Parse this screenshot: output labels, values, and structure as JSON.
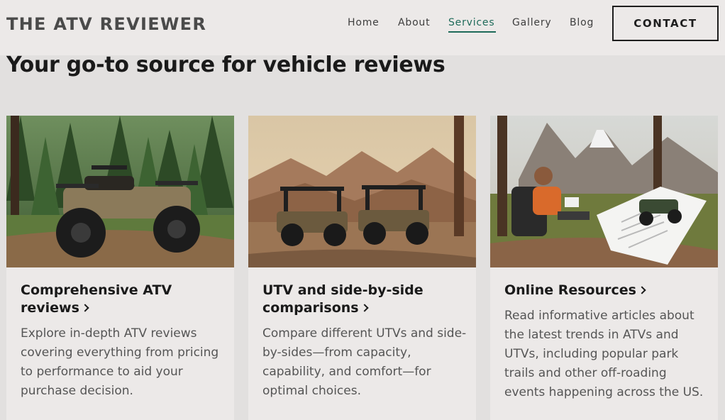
{
  "header": {
    "logo": "THE ATV REVIEWER",
    "nav": [
      {
        "label": "Home",
        "active": false
      },
      {
        "label": "About",
        "active": false
      },
      {
        "label": "Services",
        "active": true
      },
      {
        "label": "Gallery",
        "active": false
      },
      {
        "label": "Blog",
        "active": false
      }
    ],
    "contact_label": "CONTACT"
  },
  "hero": {
    "heading": "Your go-to source for vehicle reviews"
  },
  "cards": [
    {
      "title": "Comprehensive ATV reviews",
      "description": "Explore in-depth ATV reviews covering everything from pricing to performance to aid your purchase decision.",
      "image": "atv-in-forest-image"
    },
    {
      "title": "UTV and side-by-side comparisons",
      "description": "Compare different UTVs and side-by-sides—from capacity, capability, and comfort—for optimal choices.",
      "image": "two-utvs-in-desert-image"
    },
    {
      "title": "Online Resources",
      "description": "Read informative articles about the latest trends in ATVs and UTVs, including popular park trails and other off-roading events happening across the US.",
      "image": "man-reading-atv-article-image"
    }
  ],
  "colors": {
    "page_bg": "#e2e0df",
    "card_bg": "#ece9e8",
    "accent": "#1f6b5a",
    "text": "#1a1a1a",
    "muted_text": "#555555"
  }
}
